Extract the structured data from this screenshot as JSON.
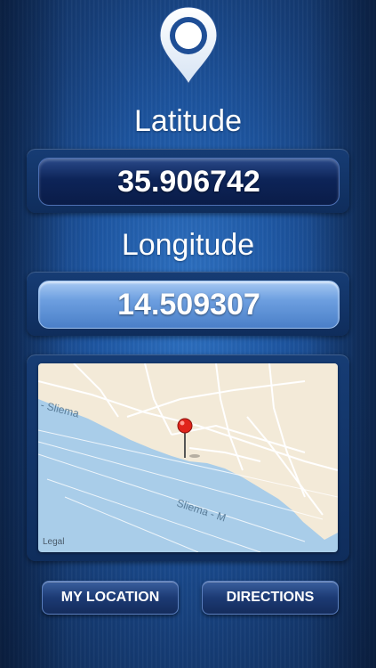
{
  "header": {
    "icon": "location-pin-icon"
  },
  "latitude": {
    "label": "Latitude",
    "value": "35.906742"
  },
  "longitude": {
    "label": "Longitude",
    "value": "14.509307"
  },
  "map": {
    "place_labels": [
      "- Sliema",
      "Sliema - M"
    ],
    "legal_label": "Legal",
    "marker_icon": "map-marker-icon"
  },
  "actions": {
    "my_location_label": "MY LOCATION",
    "directions_label": "DIRECTIONS"
  },
  "colors": {
    "background": "#1e57a3",
    "latitude_field": "#0d2458",
    "longitude_field": "#6d9fe0",
    "land": "#f3ead8",
    "water": "#a9cde9",
    "marker": "#e0241b"
  }
}
